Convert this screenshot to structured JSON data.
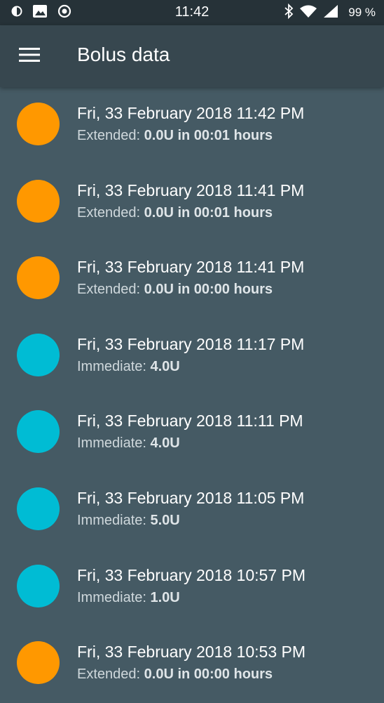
{
  "status_bar": {
    "time": "11:42",
    "battery": "99 %",
    "icons_left": [
      "data-saver-icon",
      "image-icon",
      "record-icon"
    ],
    "icons_right": [
      "bluetooth-icon",
      "wifi-icon",
      "signal-icon",
      "battery-icon"
    ]
  },
  "app_bar": {
    "menu_icon": "hamburger-menu-icon",
    "title": "Bolus data"
  },
  "colors": {
    "extended": "#ff9800",
    "immediate": "#00bcd4"
  },
  "items": [
    {
      "type": "extended",
      "date": "Fri, 33 February 2018 11:42 PM",
      "label": "Extended:",
      "value": "0.0U in 00:01 hours"
    },
    {
      "type": "extended",
      "date": "Fri, 33 February 2018 11:41 PM",
      "label": "Extended:",
      "value": "0.0U in 00:01 hours"
    },
    {
      "type": "extended",
      "date": "Fri, 33 February 2018 11:41 PM",
      "label": "Extended:",
      "value": "0.0U in 00:00 hours"
    },
    {
      "type": "immediate",
      "date": "Fri, 33 February 2018 11:17 PM",
      "label": "Immediate:",
      "value": "4.0U"
    },
    {
      "type": "immediate",
      "date": "Fri, 33 February 2018 11:11 PM",
      "label": "Immediate:",
      "value": "4.0U"
    },
    {
      "type": "immediate",
      "date": "Fri, 33 February 2018 11:05 PM",
      "label": "Immediate:",
      "value": "5.0U"
    },
    {
      "type": "immediate",
      "date": "Fri, 33 February 2018 10:57 PM",
      "label": "Immediate:",
      "value": "1.0U"
    },
    {
      "type": "extended",
      "date": "Fri, 33 February 2018 10:53 PM",
      "label": "Extended:",
      "value": "0.0U in 00:00 hours"
    }
  ]
}
